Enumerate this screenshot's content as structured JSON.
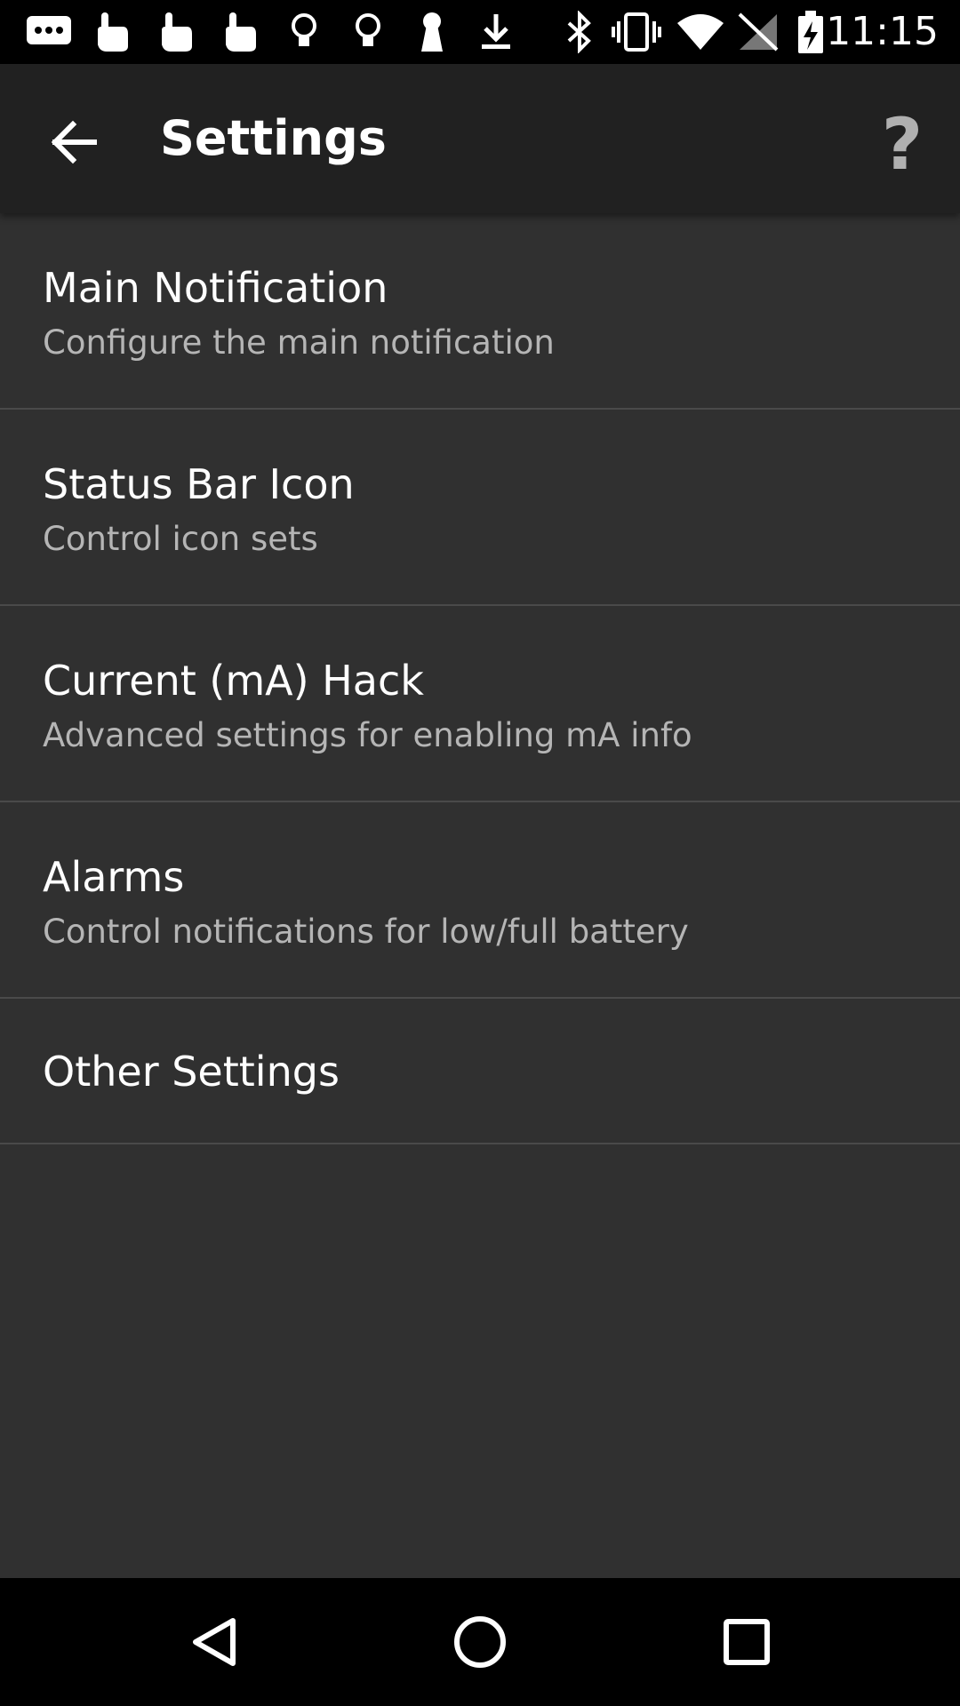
{
  "status_bar": {
    "time": "11:15",
    "left_icons": [
      "message-icon",
      "touch-icon",
      "touch-icon",
      "touch-icon",
      "bulb-icon",
      "bulb-icon",
      "keyhole-icon",
      "download-icon"
    ],
    "right_icons": [
      "bluetooth-icon",
      "vibrate-icon",
      "wifi-icon",
      "signal-icon",
      "battery-charging-icon"
    ]
  },
  "app_bar": {
    "title": "Settings",
    "back_icon": "arrow-back-icon",
    "help_label": "?"
  },
  "settings": {
    "items": [
      {
        "title": "Main Notification",
        "subtitle": "Configure the main notification"
      },
      {
        "title": "Status Bar Icon",
        "subtitle": "Control icon sets"
      },
      {
        "title": "Current (mA) Hack",
        "subtitle": "Advanced settings for enabling mA info"
      },
      {
        "title": "Alarms",
        "subtitle": "Control notifications for low/full battery"
      },
      {
        "title": "Other Settings"
      }
    ]
  },
  "nav_bar": {
    "buttons": [
      "back-triangle-icon",
      "home-circle-icon",
      "recents-square-icon"
    ]
  },
  "colors": {
    "background": "#303030",
    "app_bar": "#212121",
    "subtitle": "#b5b5b5",
    "divider": "#4a4a4a"
  }
}
